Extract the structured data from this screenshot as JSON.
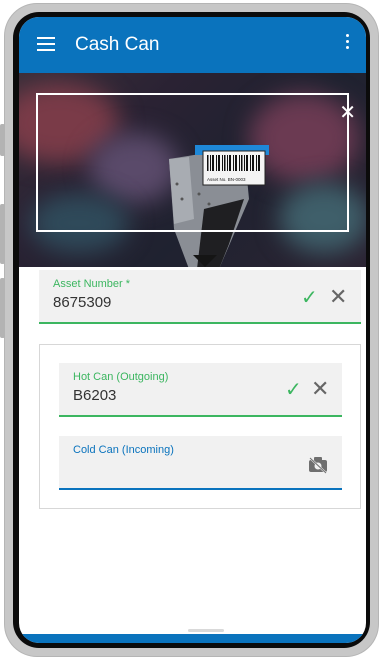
{
  "app": {
    "title": "Cash Can"
  },
  "scanner": {
    "label_text": "Asset No.  BN-0003"
  },
  "asset_field": {
    "label": "Asset Number *",
    "value": "8675309"
  },
  "hot_can": {
    "label": "Hot Can (Outgoing)",
    "value": "B6203"
  },
  "cold_can": {
    "label": "Cold Can (Incoming)",
    "value": ""
  },
  "icons": {
    "menu": "menu-icon",
    "more": "more-vert-icon",
    "close": "close-icon",
    "confirm": "check-icon",
    "clear": "clear-icon",
    "camera_off": "camera-off-icon"
  },
  "colors": {
    "appbar": "#0a73bd",
    "valid": "#3cb660",
    "focus": "#0a73bd"
  }
}
